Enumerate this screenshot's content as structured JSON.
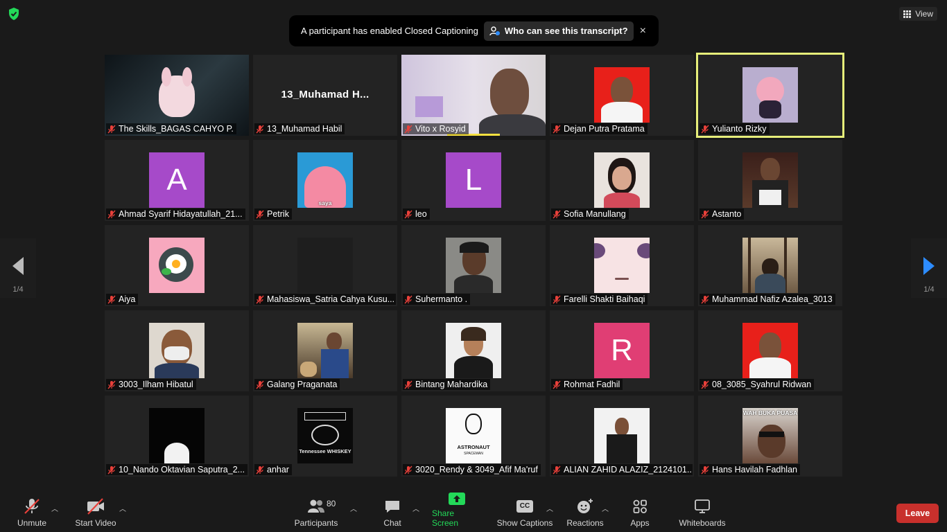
{
  "window": {
    "view_label": "View"
  },
  "banner": {
    "message": "A participant has enabled Closed Captioning",
    "who_button": "Who can see this transcript?",
    "close": "×"
  },
  "pager": {
    "left_label": "1/4",
    "right_label": "1/4"
  },
  "participants": [
    {
      "name": "The Skills_BAGAS CAHYO P.",
      "kind": "video",
      "avatar": "bunny-headphones"
    },
    {
      "name": "13_Muhamad Habil",
      "kind": "name",
      "display": "13_Muhamad  H..."
    },
    {
      "name": "Vito x Rosyid",
      "kind": "video",
      "avatar": "webcam-man"
    },
    {
      "name": "Dejan Putra Pratama",
      "kind": "photo",
      "avatar": "red-bg-portrait"
    },
    {
      "name": "Yulianto Rizky",
      "kind": "photo",
      "avatar": "anime-girl"
    },
    {
      "name": "Ahmad Syarif Hidayatullah_21...",
      "kind": "letter",
      "letter": "A",
      "color": "#a64ac9"
    },
    {
      "name": "Petrik",
      "kind": "photo",
      "avatar": "patrick-star",
      "caption": "saya"
    },
    {
      "name": "leo",
      "kind": "letter",
      "letter": "L",
      "color": "#a64ac9"
    },
    {
      "name": "Sofia Manullang",
      "kind": "photo",
      "avatar": "woman-portrait"
    },
    {
      "name": "Astanto",
      "kind": "photo",
      "avatar": "man-dark-room"
    },
    {
      "name": "Aiya",
      "kind": "photo",
      "avatar": "fried-egg-pan"
    },
    {
      "name": "Mahasiswa_Satria Cahya Kusu...",
      "kind": "photo",
      "avatar": "dark"
    },
    {
      "name": "Suhermanto .",
      "kind": "photo",
      "avatar": "man-thinking"
    },
    {
      "name": "Farelli Shakti Baihaqi",
      "kind": "photo",
      "avatar": "anime-face-closeup"
    },
    {
      "name": "Muhammad Nafiz Azalea_3013",
      "kind": "photo",
      "avatar": "forest-back"
    },
    {
      "name": "3003_Ilham Hibatul",
      "kind": "photo",
      "avatar": "man-mask"
    },
    {
      "name": "Galang Praganata",
      "kind": "photo",
      "avatar": "man-sitting"
    },
    {
      "name": "Bintang Mahardika",
      "kind": "photo",
      "avatar": "peace-sign"
    },
    {
      "name": "Rohmat Fadhil",
      "kind": "letter",
      "letter": "R",
      "color": "#e03e74"
    },
    {
      "name": "08_3085_Syahrul Ridwan",
      "kind": "photo",
      "avatar": "red-bg-portrait"
    },
    {
      "name": "10_Nando Oktavian Saputra_2...",
      "kind": "photo",
      "avatar": "cat-in-dark"
    },
    {
      "name": "anhar",
      "kind": "photo",
      "avatar": "jack-daniels-logo",
      "logo_text": "Tennessee WHISKEY"
    },
    {
      "name": "3020_Rendy & 3049_Afif Ma'ruf",
      "kind": "photo",
      "avatar": "astronaut-logo",
      "logo_text": "ASTRONAUT",
      "logo_sub": "SPACEMAN"
    },
    {
      "name": "ALIAN ZAHID ALAZIZ_2124101...",
      "kind": "photo",
      "avatar": "man-suit"
    },
    {
      "name": "Hans Havilah Fadhlan",
      "kind": "photo",
      "avatar": "meme",
      "caption": "WAH BUKA PUASA"
    }
  ],
  "toolbar": {
    "unmute": "Unmute",
    "start_video": "Start Video",
    "participants": "Participants",
    "participant_count": "80",
    "chat": "Chat",
    "share_screen": "Share Screen",
    "show_captions": "Show Captions",
    "reactions": "Reactions",
    "apps": "Apps",
    "whiteboards": "Whiteboards",
    "leave": "Leave",
    "cc_badge": "CC"
  },
  "colors": {
    "accent_green": "#23d959",
    "leave_red": "#c8302c",
    "active_speaker": "#e6ee7a",
    "muted_red": "#e8403a"
  }
}
